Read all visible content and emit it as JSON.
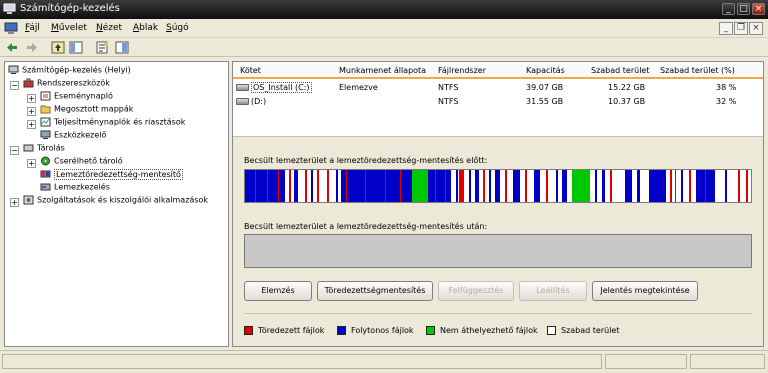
{
  "window": {
    "title": "Számítógép-kezelés"
  },
  "menu": [
    {
      "label": "Fájl",
      "u": "F",
      "rest": "ájl"
    },
    {
      "label": "Művelet",
      "u": "M",
      "rest": "űvelet"
    },
    {
      "label": "Nézet",
      "u": "N",
      "rest": "ézet"
    },
    {
      "label": "Ablak",
      "u": "A",
      "rest": "blak"
    },
    {
      "label": "Súgó",
      "u": "S",
      "rest": "úgó"
    }
  ],
  "tree": {
    "root": "Számítógép-kezelés (Helyi)",
    "system_tools": "Rendszereszközök",
    "event_viewer": "Eseménynapló",
    "shared_folders": "Megosztott mappák",
    "perf_logs": "Teljesítménynaplók és riasztások",
    "device_manager": "Eszközkezelő",
    "storage": "Tárolás",
    "removable": "Cserélhető tároló",
    "defrag": "Lemeztöredezettség-mentesítő",
    "disk_mgmt": "Lemezkezelés",
    "services": "Szolgáltatások és kiszolgálói alkalmazások"
  },
  "columns": {
    "volume": "Kötet",
    "session": "Munkamenet állapota",
    "fs": "Fájlrendszer",
    "capacity": "Kapacitás",
    "free": "Szabad terület",
    "free_pct": "Szabad terület (%)"
  },
  "volumes": [
    {
      "name": "OS_Install (C:)",
      "status": "Elemezve",
      "fs": "NTFS",
      "capacity": "39.07 GB",
      "free": "15.22 GB",
      "pct": "38 %"
    },
    {
      "name": "(D:)",
      "status": "",
      "fs": "NTFS",
      "capacity": "31.55 GB",
      "free": "10.37 GB",
      "pct": "32 %"
    }
  ],
  "labels": {
    "before": "Becsült lemezterület a lemeztöredezettség-mentesítés előtt:",
    "after": "Becsült lemezterület a lemeztöredezettség-mentesítés után:"
  },
  "buttons": {
    "analyze": "Elemzés",
    "defrag": "Töredezettségmentesítés",
    "pause": "Felfüggesztés",
    "stop": "Leállítás",
    "report": "Jelentés megtekintése"
  },
  "legend": {
    "fragmented": "Töredezett fájlok",
    "contiguous": "Folytonos fájlok",
    "unmovable": "Nem áthelyezhető fájlok",
    "free": "Szabad terület"
  },
  "colors": {
    "fragmented": "#e00000",
    "contiguous": "#0000c8",
    "unmovable": "#00c800",
    "free": "#ffffff"
  }
}
